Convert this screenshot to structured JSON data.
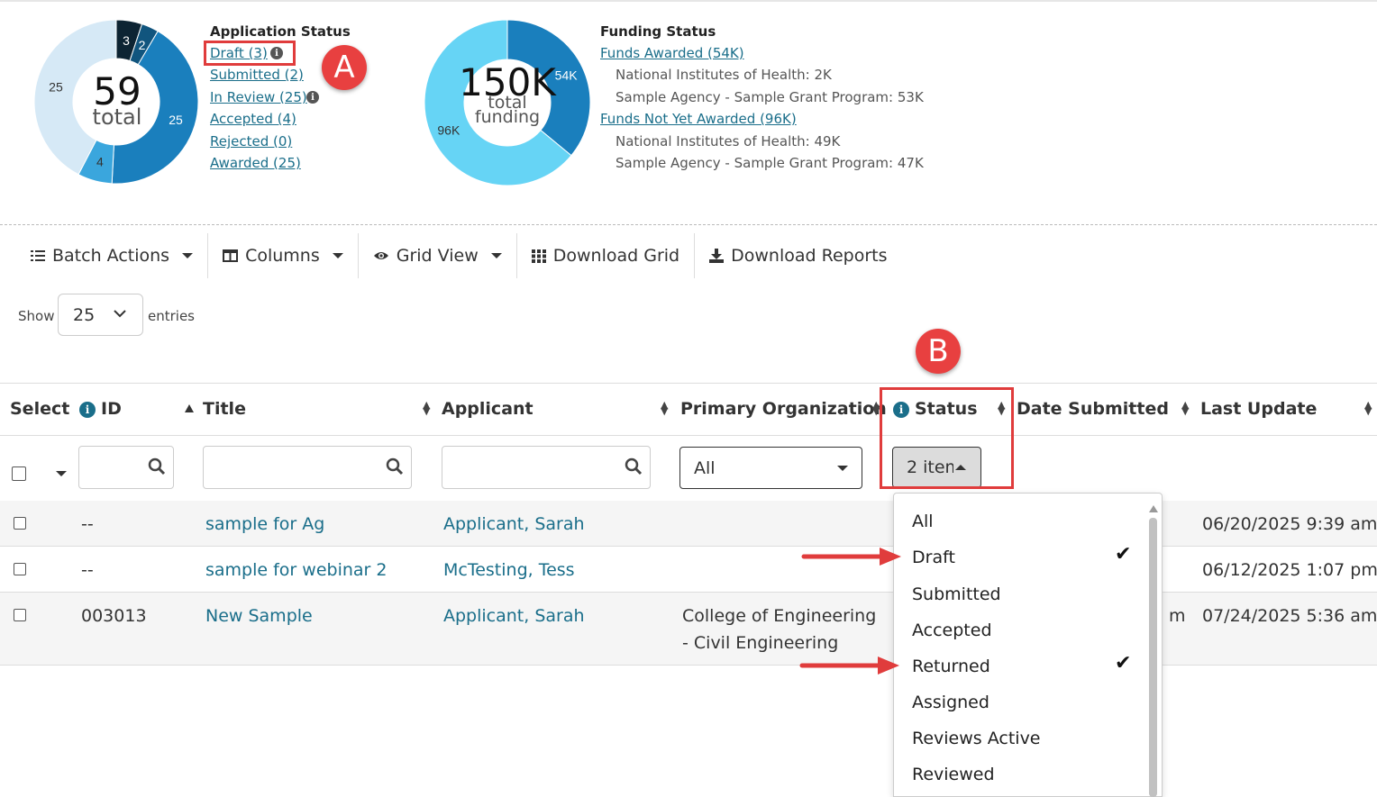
{
  "app_status": {
    "title": "Application Status",
    "total_value": "59",
    "total_label": "total",
    "links": [
      {
        "label": "Draft (3)"
      },
      {
        "label": "Submitted (2)"
      },
      {
        "label": "In Review (25)"
      },
      {
        "label": "Accepted (4)"
      },
      {
        "label": "Rejected (0)"
      },
      {
        "label": "Awarded (25)"
      }
    ],
    "donut": {
      "segments": [
        {
          "name": "Draft",
          "value": 3,
          "label": "3",
          "color": "#0d2433"
        },
        {
          "name": "Submitted",
          "value": 2,
          "label": "2",
          "color": "#11557e"
        },
        {
          "name": "Awarded",
          "value": 25,
          "label": "25",
          "color": "#1a7fbd"
        },
        {
          "name": "Accepted",
          "value": 4,
          "label": "4",
          "color": "#3aa6dd"
        },
        {
          "name": "In Review",
          "value": 25,
          "label": "25",
          "color": "#d6e9f6"
        }
      ]
    }
  },
  "funding": {
    "title": "Funding Status",
    "total_value": "150K",
    "total_label_1": "total",
    "total_label_2": "funding",
    "awarded_link": "Funds Awarded (54K)",
    "awarded_lines": [
      "National Institutes of Health: 2K",
      "Sample Agency - Sample Grant Program: 53K"
    ],
    "not_awarded_link": "Funds Not Yet Awarded (96K)",
    "not_awarded_lines": [
      "National Institutes of Health: 49K",
      "Sample Agency - Sample Grant Program: 47K"
    ],
    "donut": {
      "segments": [
        {
          "name": "Awarded",
          "value": 54,
          "label": "54K",
          "color": "#1a7fbd"
        },
        {
          "name": "Not Yet Awarded",
          "value": 96,
          "label": "96K",
          "color": "#66d4f5"
        }
      ]
    }
  },
  "annotations": {
    "a": "A",
    "b": "B"
  },
  "toolbar": {
    "batch": "Batch Actions",
    "columns": "Columns",
    "grid_view": "Grid View",
    "download_grid": "Download Grid",
    "download_reports": "Download Reports"
  },
  "show_entries": {
    "show": "Show",
    "value": "25",
    "entries": "entries"
  },
  "table": {
    "headers": {
      "select": "Select",
      "id": "ID",
      "title": "Title",
      "applicant": "Applicant",
      "primary_org": "Primary Organization",
      "status": "Status",
      "date_submitted": "Date Submitted",
      "last_update": "Last Update"
    },
    "filters": {
      "org": "All",
      "status": "2 item"
    },
    "rows": [
      {
        "id": "--",
        "title": "sample for Ag",
        "applicant": "Applicant, Sarah",
        "org_1": "",
        "org_2": "",
        "date_tail": "",
        "last_update": "06/20/2025 9:39 am"
      },
      {
        "id": "--",
        "title": "sample for webinar 2",
        "applicant": "McTesting, Tess",
        "org_1": "",
        "org_2": "",
        "date_tail": "",
        "last_update": "06/12/2025 1:07 pm"
      },
      {
        "id": "003013",
        "title": "New Sample",
        "applicant": "Applicant, Sarah",
        "org_1": "College of Engineering",
        "org_2": "- Civil Engineering",
        "date_tail": "m",
        "last_update": "07/24/2025 5:36 am"
      }
    ]
  },
  "status_dropdown": {
    "options": [
      {
        "label": "All",
        "checked": false
      },
      {
        "label": "Draft",
        "checked": true
      },
      {
        "label": "Submitted",
        "checked": false
      },
      {
        "label": "Accepted",
        "checked": false
      },
      {
        "label": "Returned",
        "checked": true
      },
      {
        "label": "Assigned",
        "checked": false
      },
      {
        "label": "Reviews Active",
        "checked": false
      },
      {
        "label": "Reviewed",
        "checked": false
      }
    ]
  },
  "colors": {
    "link": "#1a6e8a",
    "annotation_red": "#e03c3c"
  }
}
